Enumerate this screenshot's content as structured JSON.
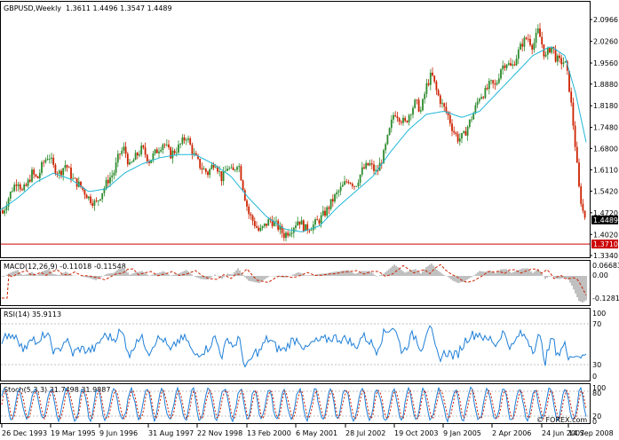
{
  "header": {
    "symbol": "GBPUSD,Weekly",
    "ohlc": "1.3611 1.4496 1.3547 1.4489"
  },
  "colors": {
    "background": "#ffffff",
    "candle_up": "#2e8b2e",
    "candle_down": "#cc2200",
    "moving_average": "#20b8d8",
    "hline": "#cc0000",
    "macd_hist": "#c0c0c0",
    "macd_signal": "#cc2200",
    "rsi": "#1e7fd8",
    "stoch_main": "#1e7fd8",
    "stoch_signal": "#cc2200",
    "current_price_box": "#000000",
    "hline_box": "#cc0000"
  },
  "price_axis": {
    "ticks": [
      "2.0966",
      "2.0260",
      "1.9560",
      "1.8880",
      "1.8180",
      "1.7480",
      "1.6800",
      "1.6110",
      "1.5420",
      "1.4720",
      "1.4020",
      "1.3340"
    ],
    "current_price": "1.4489",
    "hline_price": "1.3710"
  },
  "macd": {
    "label": "MACD(12,26,9) -0.11018 -0.11548",
    "ticks": [
      "0.06683",
      "0.00",
      "-0.12812"
    ]
  },
  "rsi": {
    "label": "RSI(14) 35.9113",
    "ticks": [
      "100",
      "70",
      "30",
      "0"
    ]
  },
  "stoch": {
    "label": "Stoch(5,3,3) 31.7498 31.9887",
    "ticks": [
      "100",
      "80",
      "20",
      "0"
    ]
  },
  "time_axis": {
    "labels": [
      "26 Dec 1993",
      "19 Mar 1995",
      "9 Jun 1996",
      "31 Aug 1997",
      "22 Nov 1998",
      "13 Feb 2000",
      "6 May 2001",
      "28 Jul 2002",
      "19 Oct 2003",
      "9 Jan 2005",
      "2 Apr 2006",
      "24 Jun 2007",
      "14 Sep 2008"
    ]
  },
  "watermark": "© FOREX.com",
  "chart_data": {
    "type": "candlestick",
    "series_path": [
      [
        0,
        1.5
      ],
      [
        3,
        1.47
      ],
      [
        8,
        1.51
      ],
      [
        14,
        1.55
      ],
      [
        20,
        1.58
      ],
      [
        25,
        1.54
      ],
      [
        30,
        1.56
      ],
      [
        36,
        1.6
      ],
      [
        42,
        1.58
      ],
      [
        48,
        1.63
      ],
      [
        55,
        1.66
      ],
      [
        60,
        1.62
      ],
      [
        67,
        1.6
      ],
      [
        74,
        1.63
      ],
      [
        82,
        1.58
      ],
      [
        90,
        1.56
      ],
      [
        100,
        1.52
      ],
      [
        108,
        1.5
      ],
      [
        115,
        1.54
      ],
      [
        122,
        1.58
      ],
      [
        128,
        1.6
      ],
      [
        134,
        1.66
      ],
      [
        140,
        1.68
      ],
      [
        146,
        1.62
      ],
      [
        152,
        1.65
      ],
      [
        160,
        1.68
      ],
      [
        168,
        1.64
      ],
      [
        176,
        1.67
      ],
      [
        184,
        1.7
      ],
      [
        192,
        1.66
      ],
      [
        200,
        1.68
      ],
      [
        210,
        1.72
      ],
      [
        218,
        1.66
      ],
      [
        226,
        1.62
      ],
      [
        234,
        1.6
      ],
      [
        242,
        1.64
      ],
      [
        250,
        1.58
      ],
      [
        256,
        1.62
      ],
      [
        262,
        1.6
      ],
      [
        268,
        1.64
      ],
      [
        272,
        1.58
      ],
      [
        276,
        1.52
      ],
      [
        280,
        1.47
      ],
      [
        286,
        1.44
      ],
      [
        292,
        1.41
      ],
      [
        298,
        1.43
      ],
      [
        304,
        1.45
      ],
      [
        312,
        1.43
      ],
      [
        320,
        1.4
      ],
      [
        328,
        1.42
      ],
      [
        336,
        1.45
      ],
      [
        344,
        1.42
      ],
      [
        352,
        1.43
      ],
      [
        360,
        1.45
      ],
      [
        368,
        1.48
      ],
      [
        376,
        1.52
      ],
      [
        384,
        1.55
      ],
      [
        392,
        1.58
      ],
      [
        400,
        1.56
      ],
      [
        408,
        1.61
      ],
      [
        416,
        1.63
      ],
      [
        424,
        1.6
      ],
      [
        432,
        1.66
      ],
      [
        438,
        1.73
      ],
      [
        444,
        1.8
      ],
      [
        450,
        1.78
      ],
      [
        456,
        1.76
      ],
      [
        462,
        1.8
      ],
      [
        468,
        1.83
      ],
      [
        474,
        1.8
      ],
      [
        480,
        1.88
      ],
      [
        486,
        1.92
      ],
      [
        492,
        1.86
      ],
      [
        498,
        1.82
      ],
      [
        504,
        1.79
      ],
      [
        510,
        1.74
      ],
      [
        516,
        1.71
      ],
      [
        522,
        1.72
      ],
      [
        528,
        1.76
      ],
      [
        534,
        1.8
      ],
      [
        540,
        1.85
      ],
      [
        546,
        1.86
      ],
      [
        552,
        1.89
      ],
      [
        558,
        1.88
      ],
      [
        564,
        1.94
      ],
      [
        570,
        1.96
      ],
      [
        576,
        1.94
      ],
      [
        582,
        1.98
      ],
      [
        588,
        2.02
      ],
      [
        594,
        2.04
      ],
      [
        600,
        2.01
      ],
      [
        606,
        2.06
      ],
      [
        610,
        2.02
      ],
      [
        614,
        1.97
      ],
      [
        618,
        2.0
      ],
      [
        622,
        2.01
      ],
      [
        626,
        1.97
      ],
      [
        630,
        1.96
      ],
      [
        636,
        1.96
      ],
      [
        640,
        1.9
      ],
      [
        644,
        1.8
      ],
      [
        648,
        1.68
      ],
      [
        652,
        1.55
      ],
      [
        656,
        1.48
      ],
      [
        660,
        1.45
      ]
    ],
    "moving_average_path": [
      [
        0,
        1.48
      ],
      [
        20,
        1.52
      ],
      [
        40,
        1.57
      ],
      [
        60,
        1.6
      ],
      [
        80,
        1.58
      ],
      [
        100,
        1.54
      ],
      [
        120,
        1.55
      ],
      [
        140,
        1.6
      ],
      [
        160,
        1.63
      ],
      [
        180,
        1.65
      ],
      [
        200,
        1.66
      ],
      [
        220,
        1.66
      ],
      [
        240,
        1.63
      ],
      [
        260,
        1.59
      ],
      [
        280,
        1.52
      ],
      [
        300,
        1.46
      ],
      [
        320,
        1.42
      ],
      [
        340,
        1.41
      ],
      [
        360,
        1.43
      ],
      [
        380,
        1.49
      ],
      [
        400,
        1.54
      ],
      [
        420,
        1.59
      ],
      [
        440,
        1.67
      ],
      [
        460,
        1.74
      ],
      [
        480,
        1.79
      ],
      [
        500,
        1.8
      ],
      [
        520,
        1.78
      ],
      [
        540,
        1.8
      ],
      [
        560,
        1.86
      ],
      [
        580,
        1.92
      ],
      [
        600,
        1.98
      ],
      [
        620,
        2.01
      ],
      [
        636,
        1.98
      ],
      [
        648,
        1.86
      ],
      [
        660,
        1.7
      ]
    ]
  }
}
